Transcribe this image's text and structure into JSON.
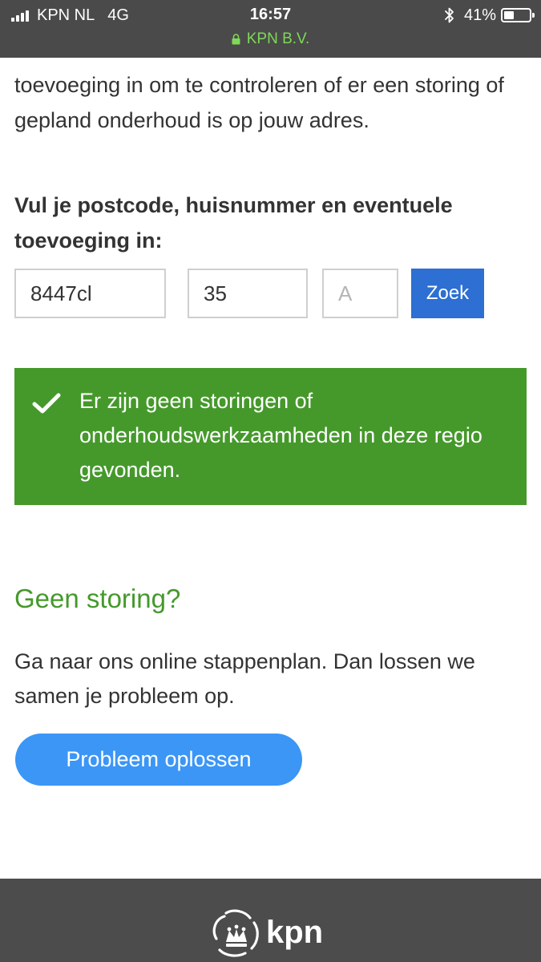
{
  "status_bar": {
    "carrier": "KPN NL",
    "network": "4G",
    "time": "16:57",
    "battery_percent": "41%",
    "battery_level": 0.41,
    "site": "KPN B.V.",
    "site_color": "#7ed957"
  },
  "intro": {
    "partial_line": "toevoeging in om te controleren of er een storing",
    "text": "toevoeging in om te controleren of er een storing of gepland onderhoud is op jouw adres."
  },
  "form": {
    "label": "Vul je postcode, huisnummer en eventuele toevoeging in:",
    "postcode_value": "8447cl",
    "huisnummer_value": "35",
    "toevoeging_placeholder": "A",
    "search_button": "Zoek",
    "button_color": "#2d6fd2"
  },
  "alert": {
    "message": "Er zijn geen storingen of onderhoudswerkzaamheden in deze regio gevonden.",
    "icon": "checkmark-icon",
    "color": "#45992b"
  },
  "help": {
    "heading": "Geen storing?",
    "text": "Ga naar ons online stappenplan. Dan lossen we samen je probleem op.",
    "button": "Probleem oplossen",
    "button_color": "#3b96f6"
  },
  "footer": {
    "logo_text": "kpn",
    "logo_icon": "kpn-crown-icon"
  }
}
